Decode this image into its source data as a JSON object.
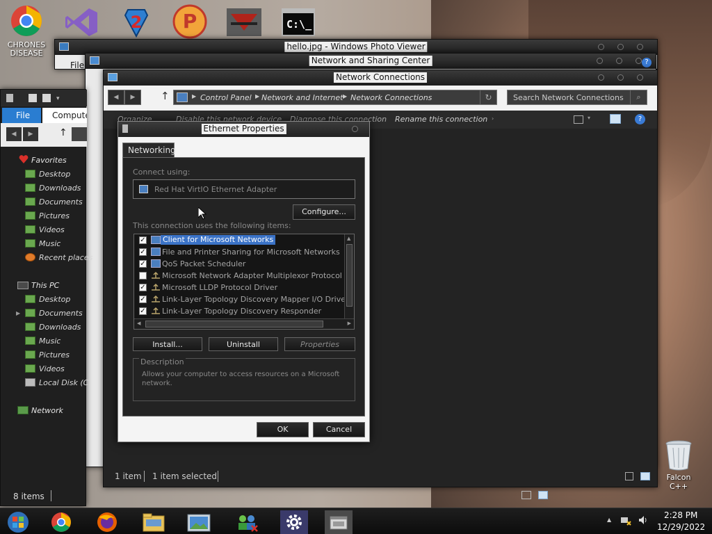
{
  "desktop": {
    "icons": [
      {
        "name": "CHRONES DISEASE",
        "label": "CHRONES\nDISEASE"
      },
      {
        "name": "visual-studio",
        "label": ""
      },
      {
        "name": "app-2",
        "label": ""
      },
      {
        "name": "app-p",
        "label": ""
      },
      {
        "name": "app-red",
        "label": ""
      },
      {
        "name": "cmd",
        "label": ""
      }
    ],
    "recycle_label": "Falcon C++",
    "chrome_label_line1": "CHRONES",
    "chrome_label_line2": "DISEASE"
  },
  "photo_viewer": {
    "title": "hello.jpg - Windows Photo Viewer"
  },
  "sharing_center": {
    "title": "Network and Sharing Center"
  },
  "explorer": {
    "tab_file": "File",
    "tab_computer": "Computer",
    "favorites_label": "Favorites",
    "favorites": [
      "Desktop",
      "Downloads",
      "Documents",
      "Pictures",
      "Videos",
      "Music",
      "Recent places"
    ],
    "this_pc_label": "This PC",
    "this_pc": [
      "Desktop",
      "Documents",
      "Downloads",
      "Music",
      "Pictures",
      "Videos",
      "Local Disk (C:"
    ],
    "network_label": "Network",
    "status": "8 items"
  },
  "back_window": {
    "file_tab": "File"
  },
  "netconn": {
    "title": "Network Connections",
    "breadcrumb": [
      "Control Panel",
      "Network and Internet",
      "Network Connections"
    ],
    "search_placeholder": "Search Network Connections",
    "commands": [
      "Organize",
      "Disable this network device",
      "Diagnose this connection",
      "Rename this connection"
    ],
    "status_items": "1 item",
    "status_selected": "1 item selected"
  },
  "dialog": {
    "title": "Ethernet Properties",
    "tab": "Networking",
    "connect_using_label": "Connect using:",
    "adapter": "Red Hat VirtIO Ethernet Adapter",
    "configure": "Configure...",
    "items_label": "This connection uses the following items:",
    "items": [
      {
        "label": "Client for Microsoft Networks",
        "checked": true,
        "selected": true,
        "icon": "network-client-icon"
      },
      {
        "label": "File and Printer Sharing for Microsoft Networks",
        "checked": true,
        "selected": false,
        "icon": "network-service-icon"
      },
      {
        "label": "QoS Packet Scheduler",
        "checked": true,
        "selected": false,
        "icon": "network-service-icon"
      },
      {
        "label": "Microsoft Network Adapter Multiplexor Protocol",
        "checked": false,
        "selected": false,
        "icon": "protocol-icon"
      },
      {
        "label": "Microsoft LLDP Protocol Driver",
        "checked": true,
        "selected": false,
        "icon": "protocol-icon"
      },
      {
        "label": "Link-Layer Topology Discovery Mapper I/O Driver",
        "checked": true,
        "selected": false,
        "icon": "protocol-icon"
      },
      {
        "label": "Link-Layer Topology Discovery Responder",
        "checked": true,
        "selected": false,
        "icon": "protocol-icon"
      }
    ],
    "install": "Install...",
    "uninstall": "Uninstall",
    "properties": "Properties",
    "description_label": "Description",
    "description": "Allows your computer to access resources on a Microsoft network.",
    "ok": "OK",
    "cancel": "Cancel"
  },
  "taskbar": {
    "time": "2:28 PM",
    "date": "12/29/2022"
  },
  "colors": {
    "selection": "#3b73c7",
    "chrome_bg": "#2a2a2a"
  }
}
